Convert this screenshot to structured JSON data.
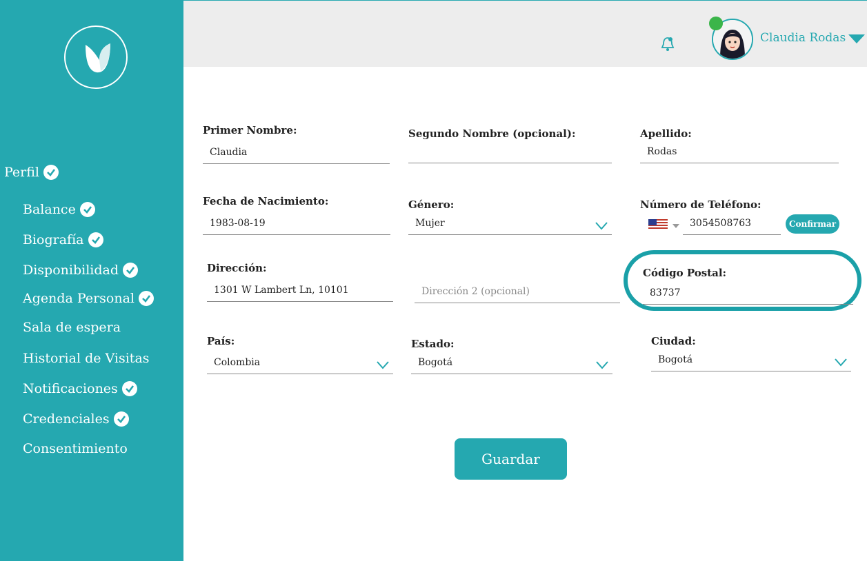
{
  "colors": {
    "accent": "#25a8b0",
    "topbar": "#ededed",
    "online": "#3bb54a"
  },
  "sidebar": {
    "logo_icon": "brand-logo-icon",
    "items": [
      {
        "label": "Perfil",
        "checked": true
      },
      {
        "label": "Balance",
        "checked": true
      },
      {
        "label": "Biografía",
        "checked": true
      },
      {
        "label": "Disponibilidad",
        "checked": true
      },
      {
        "label": "Agenda Personal",
        "checked": true
      },
      {
        "label": "Sala de espera",
        "checked": false
      },
      {
        "label": "Historial de Visitas",
        "checked": false
      },
      {
        "label": "Notificaciones",
        "checked": true
      },
      {
        "label": "Credenciales",
        "checked": true
      },
      {
        "label": "Consentimiento",
        "checked": false
      }
    ]
  },
  "header": {
    "user_name": "Claudia Rodas",
    "bell_icon": "notification-bell-icon",
    "avatar_icon": "user-avatar-icon"
  },
  "form": {
    "first_name": {
      "label": "Primer Nombre:",
      "value": "Claudia"
    },
    "middle_name": {
      "label": "Segundo Nombre (opcional):",
      "value": ""
    },
    "last_name": {
      "label": "Apellido:",
      "value": "Rodas"
    },
    "birth_date": {
      "label": "Fecha de Nacimiento:",
      "value": "1983-08-19"
    },
    "gender": {
      "label": "Género:",
      "value": "Mujer"
    },
    "phone": {
      "label": "Número de Teléfono:",
      "value": "3054508763",
      "confirm_label": "Confirmar"
    },
    "address": {
      "label": "Dirección:",
      "value": "1301 W Lambert Ln, 10101"
    },
    "address2": {
      "placeholder": "Dirección 2 (opcional)"
    },
    "postal_code": {
      "label": "Código Postal:",
      "value": "83737"
    },
    "country": {
      "label": "País:",
      "value": "Colombia"
    },
    "state": {
      "label": "Estado:",
      "value": "Bogotá"
    },
    "city": {
      "label": "Ciudad:",
      "value": "Bogotá"
    },
    "save_label": "Guardar"
  }
}
